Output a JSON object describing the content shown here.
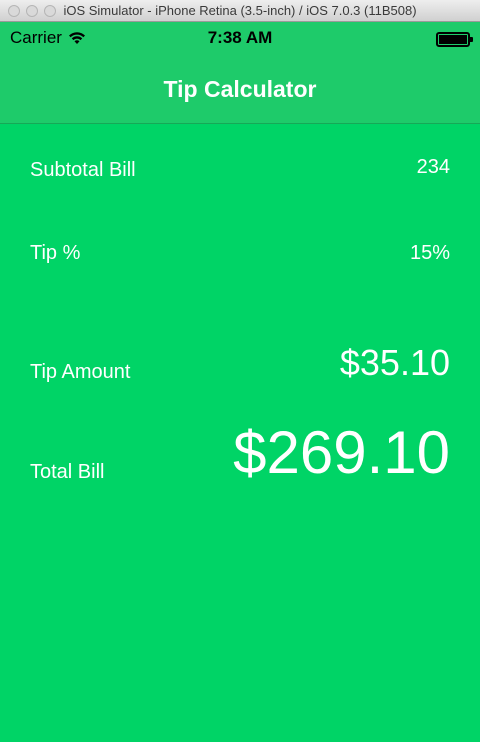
{
  "window": {
    "title": "iOS Simulator - iPhone Retina (3.5-inch) / iOS 7.0.3 (11B508)"
  },
  "status_bar": {
    "carrier": "Carrier",
    "time": "7:38 AM"
  },
  "nav": {
    "title": "Tip Calculator"
  },
  "form": {
    "subtotal_label": "Subtotal Bill",
    "subtotal_value": "234",
    "tip_label": "Tip %",
    "tip_value": "15%",
    "tip_amount_label": "Tip Amount",
    "tip_amount_value": "$35.10",
    "total_label": "Total Bill",
    "total_value": "$269.10"
  },
  "colors": {
    "background": "#00d466",
    "bar": "#1ecb6a",
    "text": "#ffffff"
  },
  "icons": {
    "wifi": "wifi-icon",
    "battery": "battery-icon"
  }
}
